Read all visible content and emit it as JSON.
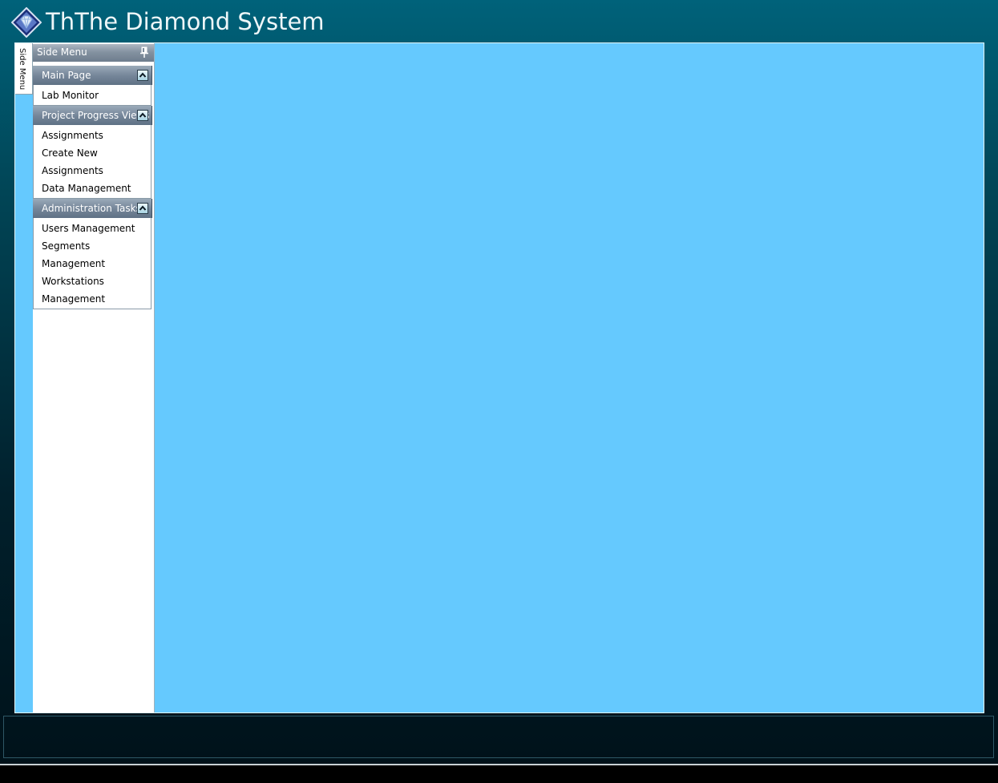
{
  "app": {
    "title": "ThThe Diamond System"
  },
  "side_tab": {
    "label": "Side Menu"
  },
  "side_menu": {
    "header": "Side Menu",
    "sections": [
      {
        "label": "Main Page",
        "expanded": true,
        "items": [
          "Lab Monitor"
        ]
      },
      {
        "label": "Project Progress Views",
        "expanded": true,
        "items": [
          "Assignments",
          "Create New",
          "Assignments",
          "Data Management"
        ]
      },
      {
        "label": "Administration Tasks",
        "expanded": true,
        "items": [
          "Users Management",
          "Segments",
          "Management",
          "Workstations",
          "Management"
        ]
      }
    ]
  },
  "colors": {
    "workspace": "#65c9fe",
    "window_top": "#00627a",
    "window_bottom": "#00121a"
  },
  "icons": {
    "logo": "diamond-logo-icon",
    "pin": "pin-icon",
    "collapse": "chevron-up-icon"
  }
}
